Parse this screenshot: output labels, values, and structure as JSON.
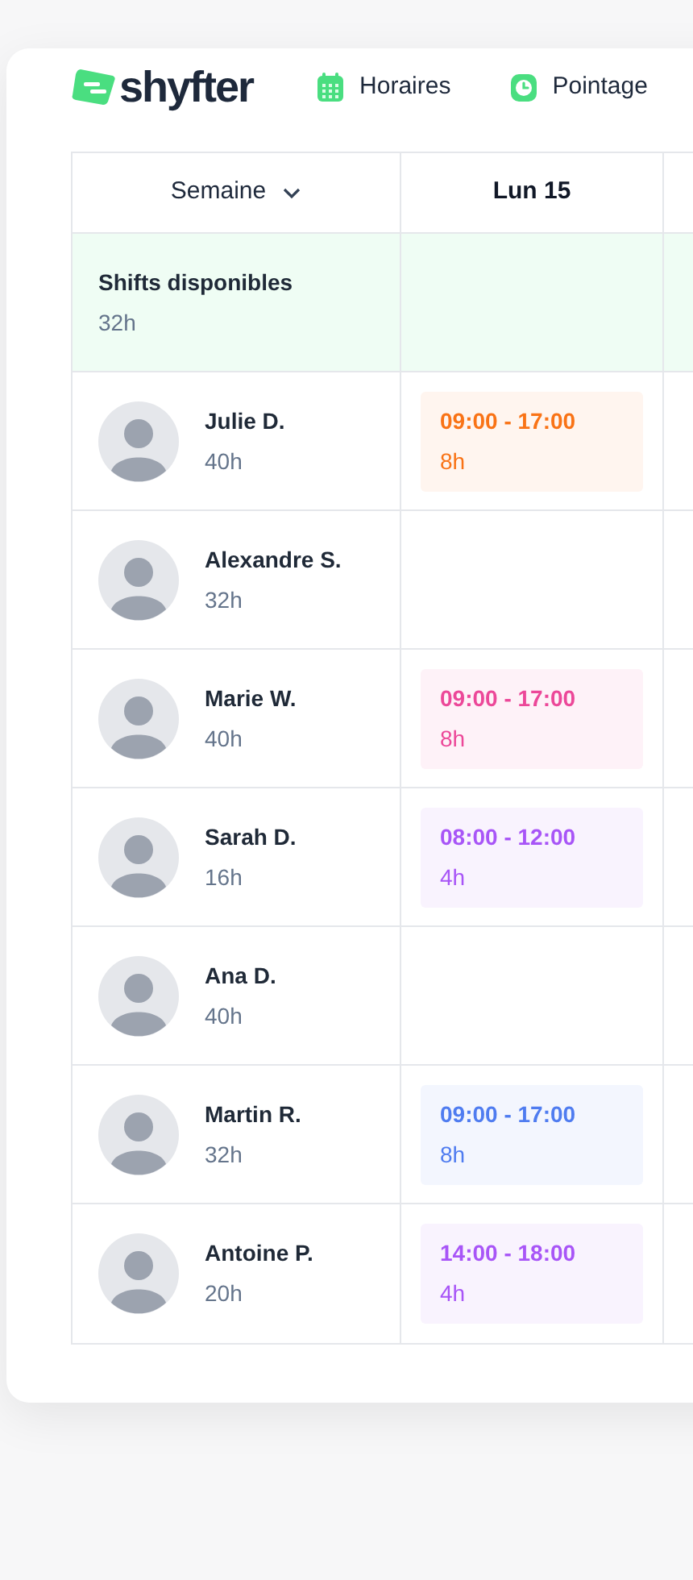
{
  "brand": {
    "name": "shyfter"
  },
  "nav": [
    {
      "label": "Horaires",
      "kind": "calendar"
    },
    {
      "label": "Pointage",
      "kind": "clock"
    }
  ],
  "table": {
    "week_selector": {
      "label": "Semaine"
    },
    "columns": [
      {
        "label": "Lun 15"
      }
    ],
    "open_shifts": {
      "label": "Shifts disponibles",
      "hours": "32h"
    },
    "rows": [
      {
        "name": "Julie D.",
        "hours": "40h",
        "shift": {
          "time": "09:00 - 17:00",
          "hours": "8h",
          "color": "#f97316"
        }
      },
      {
        "name": "Alexandre S.",
        "hours": "32h"
      },
      {
        "name": "Marie W.",
        "hours": "40h",
        "shift": {
          "time": "09:00 - 17:00",
          "hours": "8h",
          "color": "#ec4899"
        }
      },
      {
        "name": "Sarah D.",
        "hours": "16h",
        "shift": {
          "time": "08:00 - 12:00",
          "hours": "4h",
          "color": "#a855f7"
        }
      },
      {
        "name": "Ana D.",
        "hours": "40h"
      },
      {
        "name": "Martin R.",
        "hours": "32h",
        "shift": {
          "time": "09:00 - 17:00",
          "hours": "8h",
          "color": "#4f7cf0"
        }
      },
      {
        "name": "Antoine P.",
        "hours": "20h",
        "shift": {
          "time": "14:00 - 18:00",
          "hours": "4h",
          "color": "#a855f7"
        }
      }
    ]
  }
}
